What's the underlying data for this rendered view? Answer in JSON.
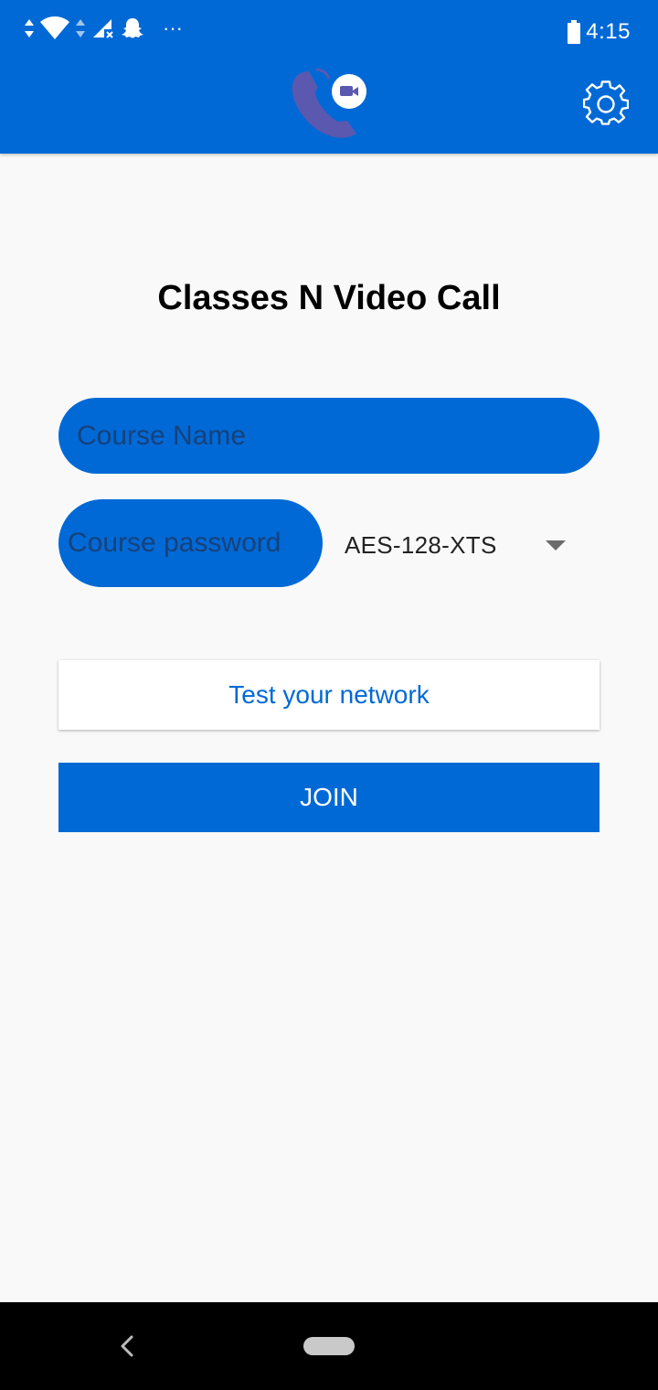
{
  "status_bar": {
    "time": "4:15",
    "left_icons": [
      "data-arrows-icon",
      "wifi-icon",
      "data-arrows-icon",
      "signal-off-icon",
      "snapchat-icon",
      "more-notifications-icon"
    ],
    "right_icons": [
      "battery-icon"
    ],
    "more_glyph": "···"
  },
  "header": {
    "logo_icon": "phone-video-call-logo",
    "settings_icon": "gear-icon"
  },
  "main": {
    "title": "Classes N Video Call",
    "course_name_placeholder": "Course Name",
    "course_password_placeholder": "Course password",
    "encryption_selected": "AES-128-XTS",
    "test_network_label": "Test your network",
    "join_label": "JOIN"
  },
  "nav_bar": {
    "back_icon": "back-chevron-icon",
    "home_icon": "home-pill-icon"
  },
  "colors": {
    "primary": "#0069d6",
    "background": "#f9f9f9",
    "nav_bar": "#000000"
  }
}
